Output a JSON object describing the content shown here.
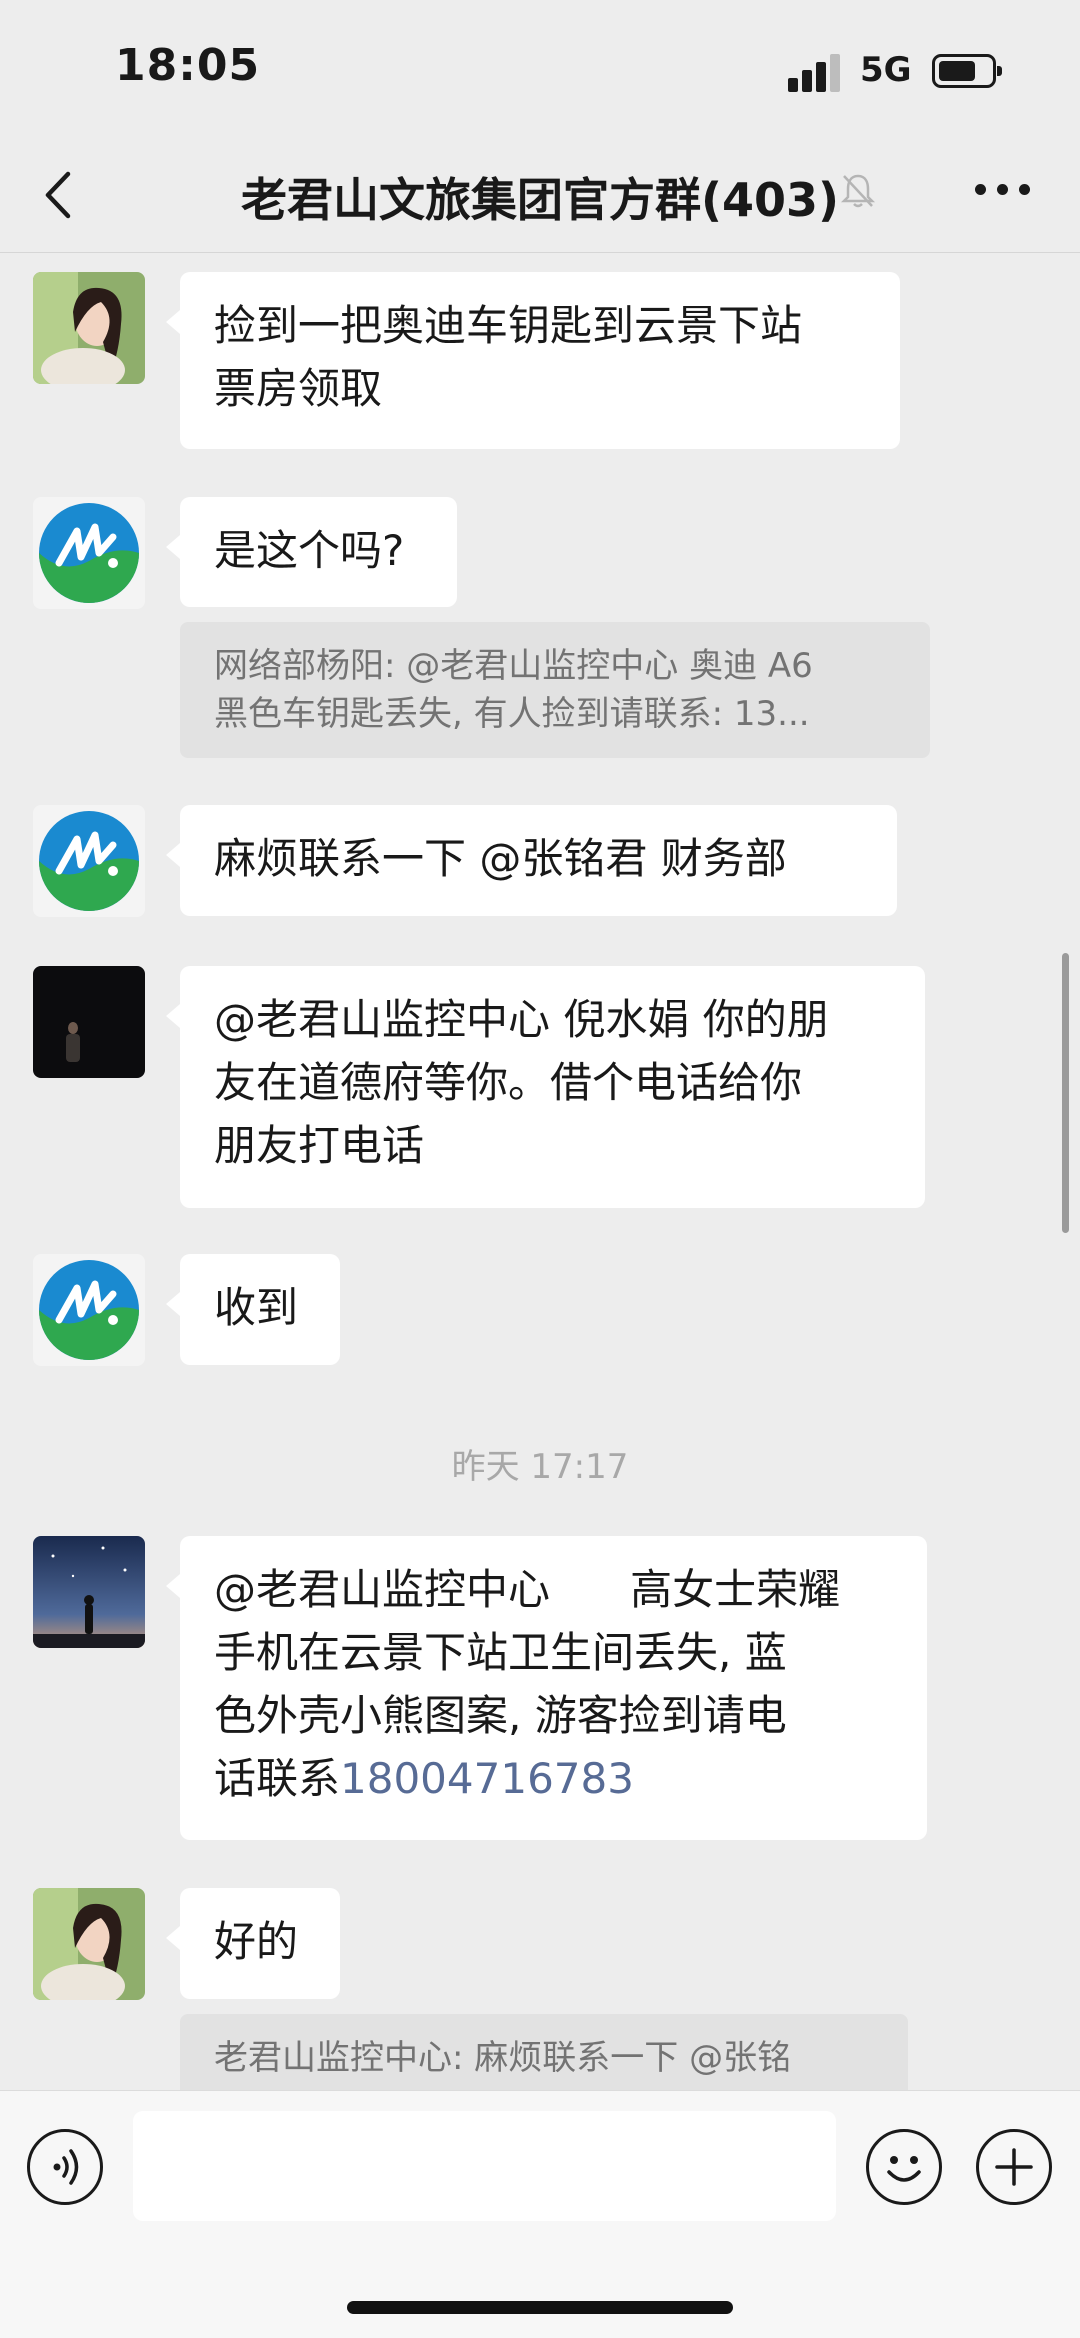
{
  "status": {
    "time": "18:05",
    "network": "5G"
  },
  "header": {
    "title": "老君山文旅集团官方群(403)"
  },
  "messages": [
    {
      "avatar": "woman-avatar",
      "lines": [
        "捡到一把奥迪车钥匙到云景下站",
        "票房领取"
      ]
    },
    {
      "avatar": "logo-avatar",
      "lines": [
        "是这个吗?"
      ],
      "quote": [
        "网络部杨阳: @老君山监控中心 奥迪 A6",
        "黑色车钥匙丢失, 有人捡到请联系: 13..."
      ]
    },
    {
      "avatar": "logo-avatar",
      "lines": [
        "麻烦联系一下 @张铭君  财务部"
      ]
    },
    {
      "avatar": "dark-person-avatar",
      "lines": [
        "@老君山监控中心 倪水娟 你的朋",
        "友在道德府等你。借个电话给你",
        "朋友打电话"
      ]
    },
    {
      "avatar": "logo-avatar",
      "lines": [
        "收到"
      ]
    },
    {
      "avatar": "night-sky-avatar",
      "lines": [
        "@老君山监控中心      高女士荣耀",
        "手机在云景下站卫生间丢失, 蓝",
        "色外壳小熊图案, 游客捡到请电"
      ],
      "last_prefix": "话联系",
      "phone": "18004716783"
    },
    {
      "avatar": "woman-avatar",
      "lines": [
        "好的"
      ],
      "quote": [
        "老君山监控中心: 麻烦联系一下 @张铭"
      ]
    }
  ],
  "timestamp": "昨天 17:17",
  "colors": {
    "background": "#ededed",
    "bubble": "#ffffff",
    "quote": "#e2e2e2",
    "link": "#576b95"
  }
}
